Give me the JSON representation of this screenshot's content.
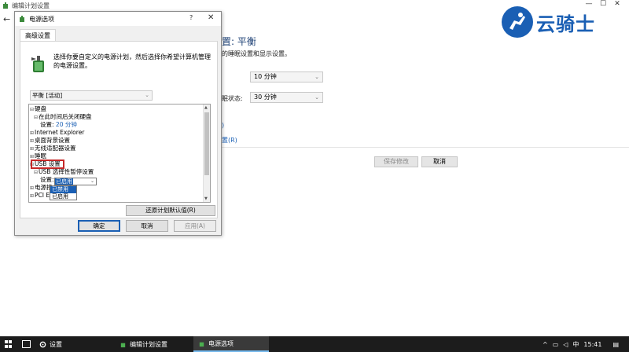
{
  "background_window": {
    "title": "编辑计划设置",
    "back": "←",
    "plan_title": "置: 平衡",
    "plan_desc": "的睡眠设置和显示设置。",
    "row1": {
      "value": "10 分钟"
    },
    "row2": {
      "label": "眠状态:",
      "value": "30 分钟"
    },
    "link1": ")",
    "link2": "置(R)",
    "save_button": "保存修改",
    "cancel_button": "取消",
    "controls": {
      "minimize": "—",
      "maximize": "☐",
      "close": "✕"
    }
  },
  "logo": {
    "text": "云骑士"
  },
  "dialog": {
    "title": "电源选项",
    "help": "?",
    "close": "✕",
    "tab": "高级设置",
    "description": "选择你要自定义的电源计划，然后选择你希望计算机管理的电源设置。",
    "plan_select": "平衡 [活动]",
    "tree": [
      {
        "exp": "⊟",
        "label": "硬盘",
        "indent": 0
      },
      {
        "exp": "⊟",
        "label": "在此时间后关闭硬盘",
        "indent": 1
      },
      {
        "exp": "",
        "label": "设置: ",
        "value": "20 分钟",
        "indent": 2
      },
      {
        "exp": "⊞",
        "label": "Internet Explorer",
        "indent": 0
      },
      {
        "exp": "⊞",
        "label": "桌面背景设置",
        "indent": 0
      },
      {
        "exp": "⊞",
        "label": "无线适配器设置",
        "indent": 0
      },
      {
        "exp": "⊞",
        "label": "睡眠",
        "indent": 0
      },
      {
        "exp": "⊟",
        "label": "USB 设置",
        "indent": 0
      },
      {
        "exp": "⊟",
        "label": "USB 选择性暂停设置",
        "indent": 1
      },
      {
        "exp": "",
        "label": "设置: ",
        "indent": 2
      },
      {
        "exp": "⊞",
        "label": "电源按",
        "indent": 0
      },
      {
        "exp": "⊞",
        "label": "PCI Exp",
        "indent": 0
      }
    ],
    "setting_select": "已启用",
    "dropdown_options": [
      "已禁用",
      "已启用"
    ],
    "restore_button": "还原计划默认值(R)",
    "ok_button": "确定",
    "cancel_button": "取消",
    "apply_button": "应用(A)"
  },
  "taskbar": {
    "settings_label": "设置",
    "item1": "编辑计划设置",
    "item2": "电源选项",
    "ime": "中",
    "time": "15:41"
  }
}
